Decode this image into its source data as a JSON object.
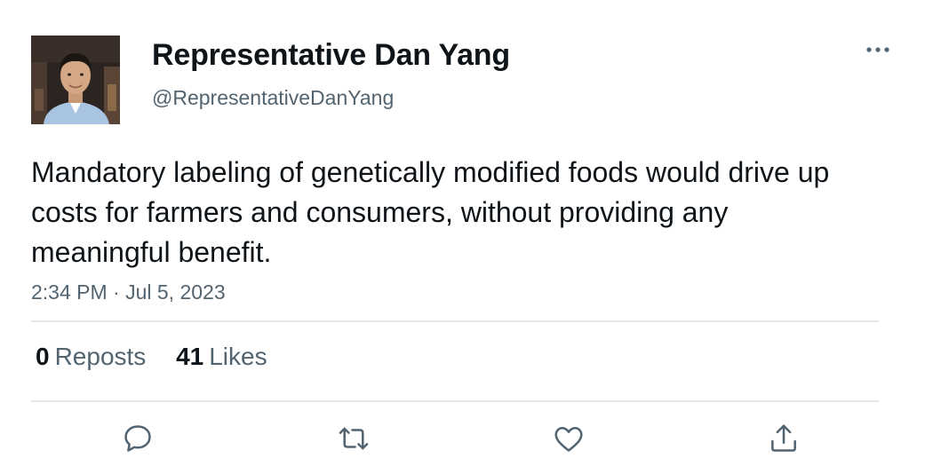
{
  "author": {
    "display_name": "Representative Dan Yang",
    "handle": "@RepresentativeDanYang",
    "avatar_icon": "profile-photo"
  },
  "tweet": {
    "text": "Mandatory labeling of genetically modified foods would drive up costs for farmers and consumers, without providing any meaningful benefit.",
    "timestamp": "2:34 PM · Jul 5, 2023"
  },
  "stats": {
    "reposts_count": "0",
    "reposts_label": "Reposts",
    "likes_count": "41",
    "likes_label": "Likes"
  },
  "actions": [
    "reply-icon",
    "repost-icon",
    "like-icon",
    "share-icon"
  ],
  "colors": {
    "text": "#0f1419",
    "secondary": "#536471",
    "divider": "#e6e9eb"
  }
}
